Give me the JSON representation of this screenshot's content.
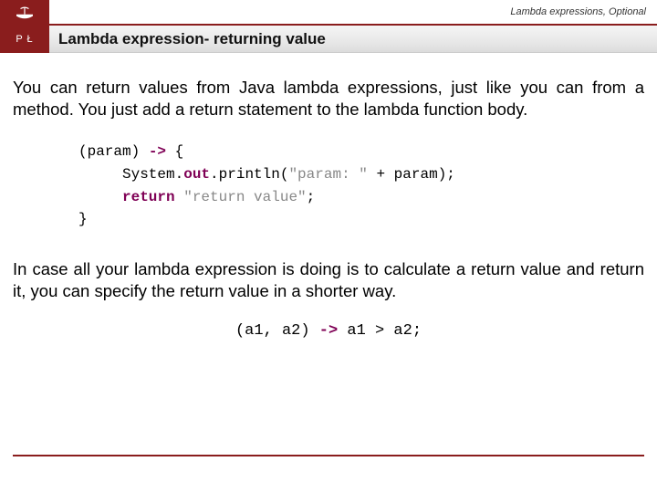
{
  "breadcrumb": "Lambda expressions, Optional",
  "logo_letters": "P  Ł",
  "title": "Lambda expression- returning value",
  "para1": "You can return values from Java lambda expressions, just like you can from a method. You just add a return statement to the lambda function body.",
  "code1": {
    "l1a": "(param) ",
    "l1b": "->",
    "l1c": " {",
    "l2a": "System.",
    "l2b": "out",
    "l2c": ".println(",
    "l2d": "\"param: \"",
    "l2e": " + param);",
    "l3a": "return",
    "l3b": " ",
    "l3c": "\"return value\"",
    "l3d": ";",
    "l4": "}"
  },
  "para2": "In case all your lambda expression is doing is to calculate a return value and return it, you can specify the return value in a shorter way.",
  "code2": {
    "a": "(a1, a2) ",
    "b": "->",
    "c": " a1 > a2;"
  }
}
